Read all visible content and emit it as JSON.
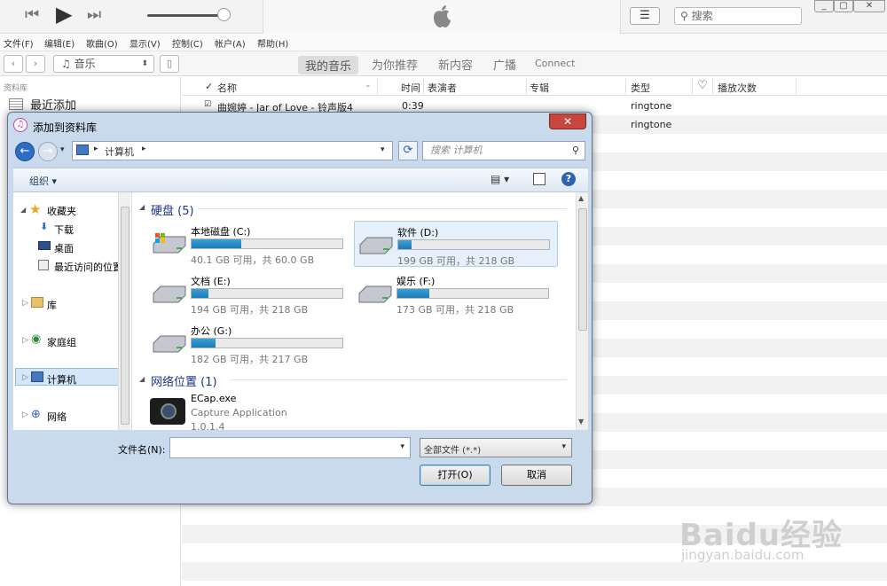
{
  "search": {
    "placeholder": "搜索"
  },
  "menu": [
    "文件(F)",
    "编辑(E)",
    "歌曲(O)",
    "显示(V)",
    "控制(C)",
    "帐户(A)",
    "帮助(H)"
  ],
  "nav": {
    "library_select": "音乐",
    "tabs": [
      "我的音乐",
      "为你推荐",
      "新内容",
      "广播",
      "Connect"
    ],
    "active_tab": 0
  },
  "sidebar": {
    "section_label": "资料库",
    "items": [
      {
        "label": "最近添加"
      }
    ]
  },
  "table": {
    "headers": [
      "名称",
      "时间",
      "表演者",
      "专辑",
      "类型",
      "播放次数"
    ],
    "rows": [
      {
        "name": "曲婉婷 - Jar of Love - 铃声版4",
        "time": "0:39",
        "artist": "",
        "album": "",
        "genre": "ringtone"
      },
      {
        "name": "",
        "time": "",
        "artist": "",
        "album": "",
        "genre": "ringtone"
      }
    ]
  },
  "dialog": {
    "title": "添加到资料库",
    "address": "计算机",
    "search_placeholder": "搜索 计算机",
    "organize": "组织",
    "nav_items": [
      "收藏夹",
      "下载",
      "桌面",
      "最近访问的位置",
      "库",
      "家庭组",
      "计算机",
      "网络"
    ],
    "hard_disk_header": "硬盘 (5)",
    "network_header": "网络位置 (1)",
    "drives": [
      {
        "name": "本地磁盘 (C:)",
        "free": "40.1 GB 可用，共 60.0 GB",
        "used_fraction": 0.33
      },
      {
        "name": "软件 (D:)",
        "free": "199 GB 可用，共 218 GB",
        "used_fraction": 0.09
      },
      {
        "name": "文档 (E:)",
        "free": "194 GB 可用，共 218 GB",
        "used_fraction": 0.11
      },
      {
        "name": "娱乐 (F:)",
        "free": "173 GB 可用，共 218 GB",
        "used_fraction": 0.21
      },
      {
        "name": "办公 (G:)",
        "free": "182 GB 可用，共 217 GB",
        "used_fraction": 0.16
      }
    ],
    "network_item": {
      "name": "ECap.exe",
      "desc": "Capture Application",
      "version": "1.0.1.4"
    },
    "filename_label": "文件名(N):",
    "filename_value": "",
    "filetype": "全部文件 (*.*)",
    "open_button": "打开(O)",
    "cancel_button": "取消"
  },
  "watermark": {
    "brand": "Baidu经验",
    "url": "jingyan.baidu.com"
  }
}
